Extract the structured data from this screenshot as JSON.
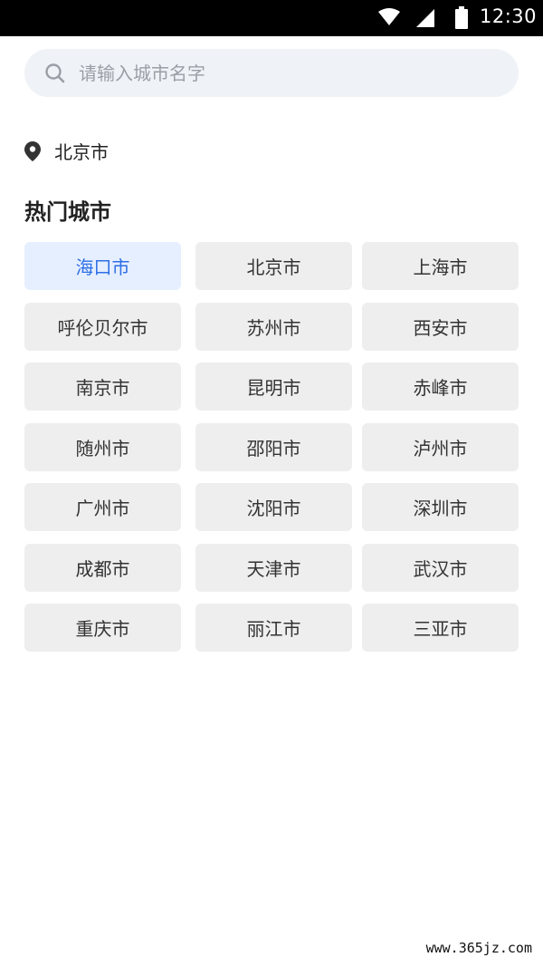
{
  "status_bar": {
    "time": "12:30",
    "icons": [
      "wifi-icon",
      "cell-signal-icon",
      "battery-icon"
    ]
  },
  "search": {
    "placeholder": "请输入城市名字",
    "value": "",
    "icon": "search-icon"
  },
  "location": {
    "icon": "location-pin-icon",
    "current_city": "北京市"
  },
  "hot_cities": {
    "title": "热门城市",
    "selected": "海口市",
    "items": [
      "海口市",
      "北京市",
      "上海市",
      "呼伦贝尔市",
      "苏州市",
      "西安市",
      "南京市",
      "昆明市",
      "赤峰市",
      "随州市",
      "邵阳市",
      "泸州市",
      "广州市",
      "沈阳市",
      "深圳市",
      "成都市",
      "天津市",
      "武汉市",
      "重庆市",
      "丽江市",
      "三亚市"
    ]
  },
  "watermark": {
    "site": "www.365jz.com"
  },
  "colors": {
    "selected_bg": "#e6efff",
    "selected_text": "#2e6fe6",
    "button_bg": "#eeeeee",
    "search_bg": "#eff2f6"
  }
}
